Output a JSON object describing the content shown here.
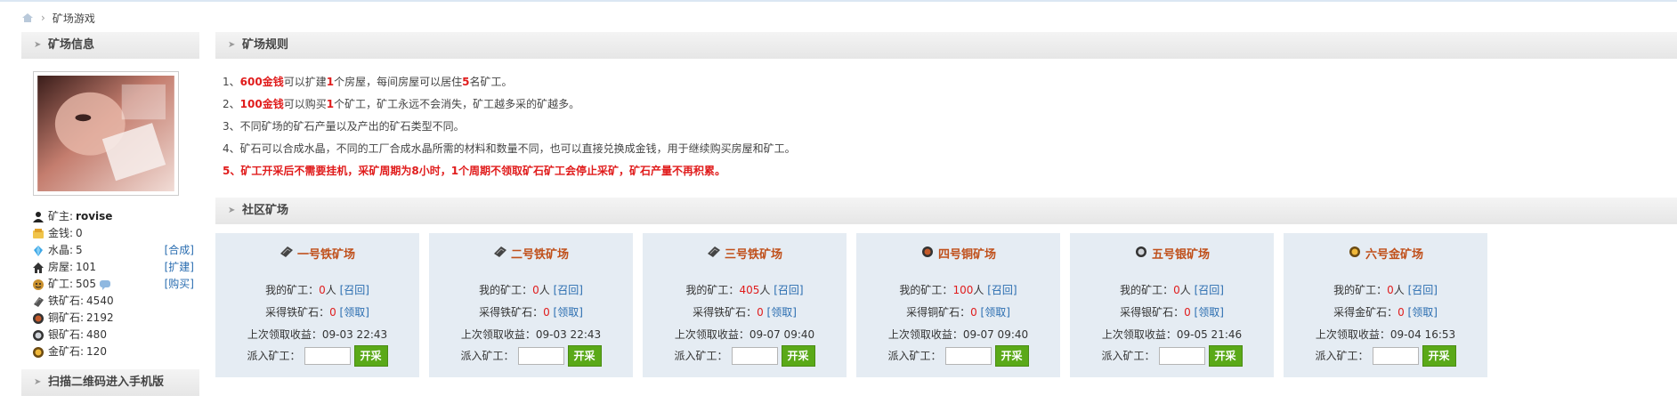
{
  "breadcrumb": {
    "current": "矿场游戏"
  },
  "sidebar": {
    "info_title": "矿场信息",
    "qr_title": "扫描二维码进入手机版",
    "stats": [
      {
        "label": "矿主:",
        "value": "rovise",
        "action": "",
        "icon": "user-icon"
      },
      {
        "label": "金钱:",
        "value": "0",
        "action": "",
        "icon": "money-icon"
      },
      {
        "label": "水晶:",
        "value": "5",
        "action": "[合成]",
        "icon": "crystal-icon"
      },
      {
        "label": "房屋:",
        "value": "101",
        "action": "[扩建]",
        "icon": "house-icon"
      },
      {
        "label": "矿工:",
        "value": "505",
        "action": "[购买]",
        "icon": "miner-icon"
      },
      {
        "label": "铁矿石:",
        "value": "4540",
        "action": "",
        "icon": "iron-ore-icon"
      },
      {
        "label": "铜矿石:",
        "value": "2192",
        "action": "",
        "icon": "copper-ore-icon"
      },
      {
        "label": "银矿石:",
        "value": "480",
        "action": "",
        "icon": "silver-ore-icon"
      },
      {
        "label": "金矿石:",
        "value": "120",
        "action": "",
        "icon": "gold-ore-icon"
      }
    ]
  },
  "rules": {
    "title": "矿场规则",
    "items": [
      {
        "n": "1、",
        "a": "600金钱",
        "b": "可以扩建",
        "c": "1",
        "d": "个房屋，每间房屋可以居住",
        "e": "5",
        "f": "名矿工。"
      },
      {
        "n": "2、",
        "a": "100金钱",
        "b": "可以购买",
        "c": "1",
        "d": "个矿工，矿工永远不会消失，矿工越多采的矿越多。",
        "e": "",
        "f": ""
      },
      {
        "n": "3、",
        "text": "不同矿场的矿石产量以及产出的矿石类型不同。"
      },
      {
        "n": "4、",
        "text": "矿石可以合成水晶，不同的工厂合成水晶所需的材料和数量不同，也可以直接兑换成金钱，用于继续购买房屋和矿工。"
      },
      {
        "n": "5、",
        "text": "矿工开采后不需要挂机，采矿周期为8小时，1个周期不领取矿石矿工会停止采矿，矿石产量不再积累。"
      }
    ]
  },
  "community": {
    "title": "社区矿场",
    "labels": {
      "my_miners": "我的矿工：",
      "unit": "人",
      "recall": "[召回]",
      "collect": "[领取]",
      "last_income": "上次领取收益：",
      "dispatch": "派入矿工：",
      "start": "开采"
    },
    "mines": [
      {
        "name": "一号铁矿场",
        "miners": "0",
        "ore_label": "采得铁矿石：",
        "ore": "0",
        "last": "09-03 22:43",
        "icon": "iron-mine-icon"
      },
      {
        "name": "二号铁矿场",
        "miners": "0",
        "ore_label": "采得铁矿石：",
        "ore": "0",
        "last": "09-03 22:43",
        "icon": "iron-mine-icon"
      },
      {
        "name": "三号铁矿场",
        "miners": "405",
        "ore_label": "采得铁矿石：",
        "ore": "0",
        "last": "09-07 09:40",
        "icon": "iron-mine-icon"
      },
      {
        "name": "四号铜矿场",
        "miners": "100",
        "ore_label": "采得铜矿石：",
        "ore": "0",
        "last": "09-07 09:40",
        "icon": "copper-mine-icon"
      },
      {
        "name": "五号银矿场",
        "miners": "0",
        "ore_label": "采得银矿石：",
        "ore": "0",
        "last": "09-05 21:46",
        "icon": "silver-mine-icon"
      },
      {
        "name": "六号金矿场",
        "miners": "0",
        "ore_label": "采得金矿石：",
        "ore": "0",
        "last": "09-04 16:53",
        "icon": "gold-mine-icon"
      }
    ]
  },
  "colors": {
    "accent_red": "#e01c1c",
    "link_blue": "#2a6db0",
    "mine_title": "#c0501b",
    "button_green": "#5aa918",
    "card_bg": "#e5ecf3"
  }
}
